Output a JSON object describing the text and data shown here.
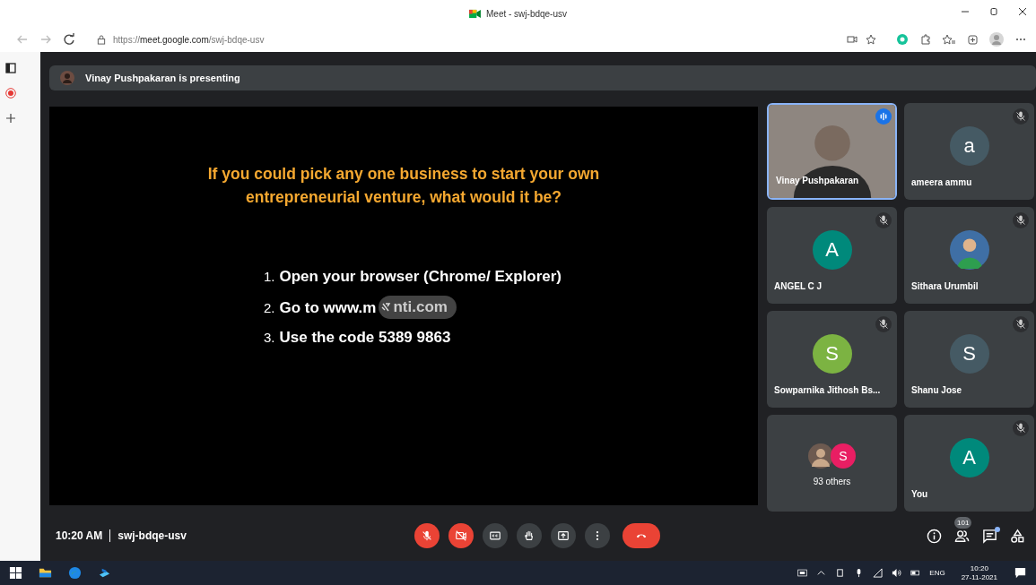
{
  "window": {
    "title": "Meet - swj-bdqe-usv"
  },
  "address_bar": {
    "scheme": "https://",
    "host": "meet.google.com",
    "path": "/swj-bdqe-usv"
  },
  "banner": {
    "text": "Vinay Pushpakaran is presenting"
  },
  "slide": {
    "question": "If you could pick any one business to start your own entrepreneurial venture, what would it be?",
    "steps": [
      {
        "number": "1.",
        "text": "Open your browser (Chrome/ Explorer)"
      },
      {
        "number": "2.",
        "text": "Go to www.m",
        "covered_text": "nti.com"
      },
      {
        "number": "3.",
        "text": "Use the code 5389 9863"
      }
    ]
  },
  "tiles": [
    {
      "kind": "video",
      "name": "Vinay Pushpakaran",
      "muted": false,
      "speaking": true
    },
    {
      "kind": "letter",
      "name": "ameera ammu",
      "initial": "a",
      "color": "#455a64",
      "muted": true,
      "speaking": false
    },
    {
      "kind": "letter",
      "name": "ANGEL C J",
      "initial": "A",
      "color": "#00897b",
      "muted": true,
      "speaking": false
    },
    {
      "kind": "photo",
      "name": "Sithara Urumbil",
      "muted": true,
      "speaking": false
    },
    {
      "kind": "letter",
      "name": "Sowparnika Jithosh Bs...",
      "initial": "S",
      "color": "#7cb342",
      "muted": true,
      "speaking": false
    },
    {
      "kind": "letter",
      "name": "Shanu Jose",
      "initial": "S",
      "color": "#455a64",
      "muted": true,
      "speaking": false
    },
    {
      "kind": "others",
      "name": "93 others",
      "initial": "S",
      "color": "#e91e63",
      "muted": false,
      "speaking": false
    },
    {
      "kind": "letter",
      "name": "You",
      "initial": "A",
      "color": "#00897b",
      "muted": true,
      "speaking": false
    }
  ],
  "footer": {
    "time": "10:20 AM",
    "meeting_code": "swj-bdqe-usv",
    "mic_on": false,
    "camera_on": false,
    "people_count": "101",
    "chat_unread": true
  },
  "taskbar": {
    "language": "ENG",
    "time": "10:20",
    "date": "27-11-2021"
  }
}
